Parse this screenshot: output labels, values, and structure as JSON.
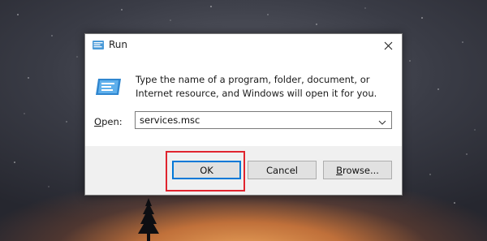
{
  "dialog": {
    "title": "Run",
    "description": "Type the name of a program, folder, document, or Internet resource, and Windows will open it for you.",
    "open_label_accel": "O",
    "open_label_rest": "pen:",
    "open_value": "services.msc",
    "buttons": {
      "ok": "OK",
      "cancel": "Cancel",
      "browse_accel": "B",
      "browse_rest": "rowse..."
    }
  },
  "icons": {
    "title": "run-icon",
    "body": "run-icon",
    "close": "close-icon",
    "dropdown": "chevron-down-icon"
  },
  "colors": {
    "highlight": "#e0242e",
    "default_button_border": "#0078d7",
    "button_face": "#e1e1e1",
    "button_strip": "#f0f0f0"
  }
}
